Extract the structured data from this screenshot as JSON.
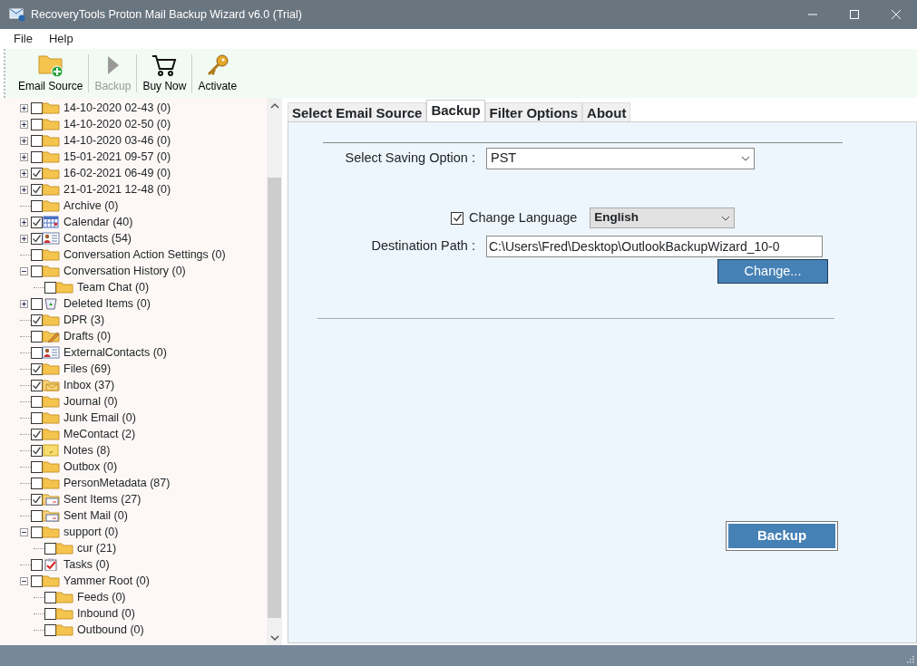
{
  "window": {
    "title": "RecoveryTools Proton Mail Backup Wizard v6.0 (Trial)"
  },
  "menu": [
    "File",
    "Help"
  ],
  "toolbar": [
    {
      "label": "Email Source",
      "kind": "folder",
      "disabled": false
    },
    {
      "label": "Backup",
      "kind": "play",
      "disabled": true
    },
    {
      "label": "Buy Now",
      "kind": "cart",
      "disabled": false
    },
    {
      "label": "Activate",
      "kind": "key",
      "disabled": false
    }
  ],
  "tree": [
    {
      "label": "14-10-2020 02-43 (0)",
      "kind": "folder",
      "checked": false,
      "expanded": false
    },
    {
      "label": "14-10-2020 02-50 (0)",
      "kind": "folder",
      "checked": false,
      "expanded": false
    },
    {
      "label": "14-10-2020 03-46 (0)",
      "kind": "folder",
      "checked": false,
      "expanded": false
    },
    {
      "label": "15-01-2021 09-57 (0)",
      "kind": "folder",
      "checked": false,
      "expanded": false
    },
    {
      "label": "16-02-2021 06-49 (0)",
      "kind": "folder",
      "checked": true,
      "expanded": false
    },
    {
      "label": "21-01-2021 12-48 (0)",
      "kind": "folder",
      "checked": true,
      "expanded": false
    },
    {
      "label": "Archive (0)",
      "kind": "folder",
      "checked": false
    },
    {
      "label": "Calendar (40)",
      "kind": "calendar",
      "checked": true,
      "expanded": false
    },
    {
      "label": "Contacts (54)",
      "kind": "contacts",
      "checked": true,
      "expanded": false
    },
    {
      "label": "Conversation Action Settings (0)",
      "kind": "folder",
      "checked": false
    },
    {
      "label": "Conversation History (0)",
      "kind": "folder",
      "checked": false,
      "expanded": true,
      "children": [
        {
          "label": "Team Chat (0)",
          "kind": "folder",
          "checked": false
        }
      ]
    },
    {
      "label": "Deleted Items (0)",
      "kind": "deleted",
      "checked": false,
      "expanded": false
    },
    {
      "label": "DPR (3)",
      "kind": "folder",
      "checked": true
    },
    {
      "label": "Drafts (0)",
      "kind": "drafts",
      "checked": false
    },
    {
      "label": "ExternalContacts (0)",
      "kind": "contacts",
      "checked": false
    },
    {
      "label": "Files (69)",
      "kind": "folder",
      "checked": true
    },
    {
      "label": "Inbox (37)",
      "kind": "inbox",
      "checked": true
    },
    {
      "label": "Journal (0)",
      "kind": "folder",
      "checked": false
    },
    {
      "label": "Junk Email (0)",
      "kind": "folder",
      "checked": false
    },
    {
      "label": "MeContact (2)",
      "kind": "folder",
      "checked": true
    },
    {
      "label": "Notes (8)",
      "kind": "notes",
      "checked": true
    },
    {
      "label": "Outbox (0)",
      "kind": "folder",
      "checked": false
    },
    {
      "label": "PersonMetadata (87)",
      "kind": "folder",
      "checked": false
    },
    {
      "label": "Sent Items (27)",
      "kind": "sent",
      "checked": true
    },
    {
      "label": "Sent Mail (0)",
      "kind": "sent",
      "checked": false
    },
    {
      "label": "support (0)",
      "kind": "folder",
      "checked": false,
      "expanded": true,
      "children": [
        {
          "label": "cur (21)",
          "kind": "folder",
          "checked": false
        }
      ]
    },
    {
      "label": "Tasks (0)",
      "kind": "tasks",
      "checked": false
    },
    {
      "label": "Yammer Root (0)",
      "kind": "folder",
      "checked": false,
      "expanded": true,
      "children": [
        {
          "label": "Feeds (0)",
          "kind": "folder",
          "checked": false
        },
        {
          "label": "Inbound (0)",
          "kind": "folder",
          "checked": false
        },
        {
          "label": "Outbound (0)",
          "kind": "folder",
          "checked": false
        }
      ]
    }
  ],
  "tabs": [
    {
      "label": "Select Email Source",
      "selected": false
    },
    {
      "label": "Backup",
      "selected": true
    },
    {
      "label": "Filter Options",
      "selected": false
    },
    {
      "label": "About",
      "selected": false
    }
  ],
  "backup": {
    "saving_option_label": "Select Saving Option :",
    "saving_option": "PST",
    "change_language": {
      "label": "Change Language",
      "checked": true,
      "value": "English"
    },
    "destination_label": "Destination Path :",
    "destination": "C:\\Users\\Fred\\Desktop\\OutlookBackupWizard_10-0",
    "change_button": "Change...",
    "backup_button": "Backup"
  }
}
